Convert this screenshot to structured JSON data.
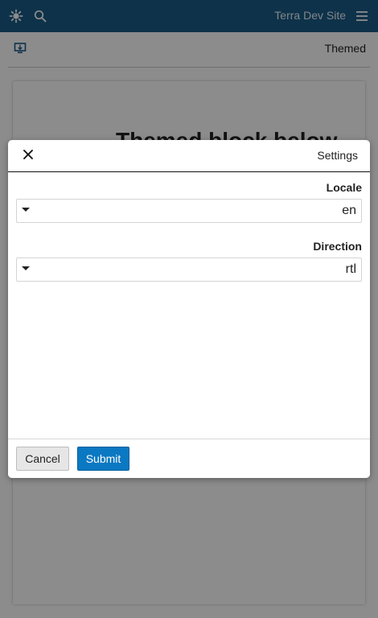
{
  "header": {
    "site_title": "Terra Dev Site",
    "icons": [
      "sun-icon",
      "search-icon",
      "hamburger-menu-icon"
    ],
    "background_color": "#1b5c88"
  },
  "subheader": {
    "logo_icon": "application-logo-icon",
    "title": "Themed"
  },
  "content": {
    "heading": "Themed block below"
  },
  "modal": {
    "title": "Settings",
    "close_icon": "close-icon",
    "fields": [
      {
        "label": "Locale",
        "value": "en"
      },
      {
        "label": "Direction",
        "value": "rtl"
      }
    ],
    "buttons": {
      "cancel": "Cancel",
      "submit": "Submit"
    },
    "submit_color": "#0a78c2"
  }
}
